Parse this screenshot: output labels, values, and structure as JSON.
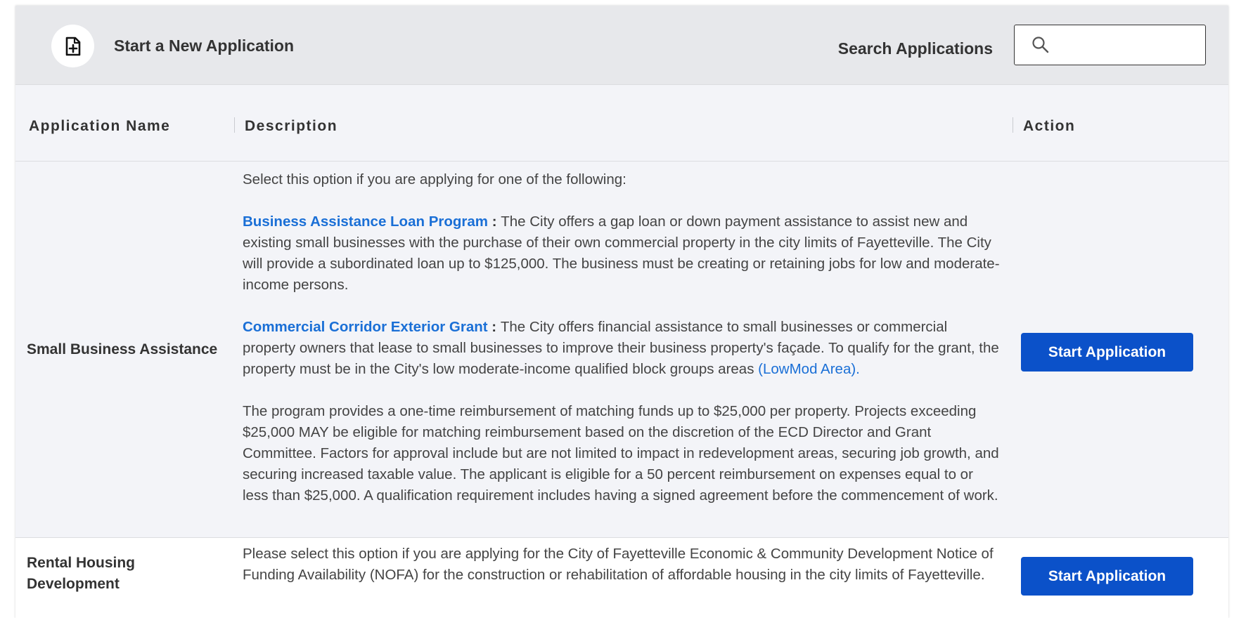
{
  "toolbar": {
    "new_application_label": "Start a New Application",
    "search_label": "Search Applications",
    "search_value": ""
  },
  "table": {
    "columns": [
      "Application Name",
      "Description",
      "Action"
    ],
    "rows": [
      {
        "name": "Small Business Assistance",
        "intro": "Select this option if you are applying for one of the following:",
        "program1_title": "Business Assistance Loan Program",
        "program1_text": "The City offers a gap loan or down payment assistance to assist new and existing small businesses with the purchase of their own commercial property in the city limits of Fayetteville. The City will provide a subordinated loan up to $125,000. The business must be creating or retaining jobs for low and moderate-income persons.",
        "program2_title": "Commercial Corridor Exterior Grant",
        "program2_text": "The City offers financial assistance to small businesses or commercial property owners that lease to small businesses to improve their business property's façade. To qualify for the grant, the property must be in the City's low moderate-income qualified block groups areas",
        "program2_link": "(LowMod Area).",
        "program2_details": "The program provides a one-time reimbursement of matching funds up to $25,000 per property. Projects exceeding $25,000 MAY be eligible for matching reimbursement based on the discretion of the ECD Director and Grant Committee. Factors for approval include but are not limited to impact in redevelopment areas, securing job growth, and securing increased taxable value. The applicant is eligible for a 50 percent reimbursement on expenses equal to or less than $25,000. A qualification requirement includes having a signed agreement before the commencement of work.",
        "action_label": "Start Application"
      },
      {
        "name": "Rental Housing Development",
        "description": "Please select this option if you are applying for the City of Fayetteville Economic & Community Development Notice of Funding Availability (NOFA) for the construction or rehabilitation of affordable housing in the city limits of Fayetteville.",
        "action_label": "Start Application"
      }
    ]
  },
  "colors": {
    "primary_button": "#0b51c9",
    "link": "#1a6fd6",
    "toolbar_bg": "#e7e8eb",
    "header_bg": "#f3f4f8"
  },
  "icons": {
    "new_application": "file-plus-icon",
    "search": "search-icon"
  }
}
